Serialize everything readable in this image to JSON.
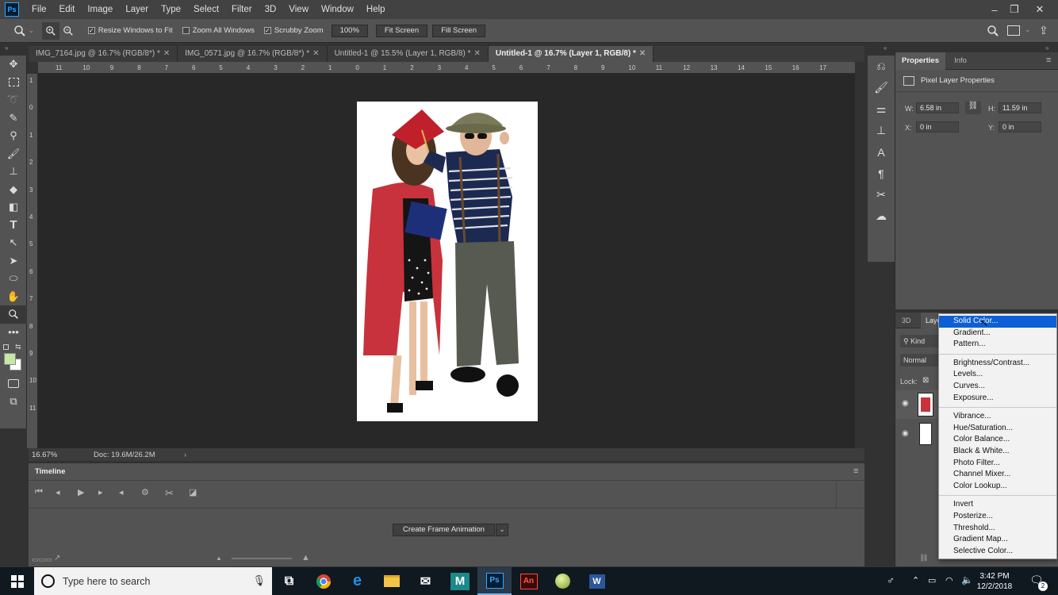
{
  "app": {
    "logo": "Ps"
  },
  "menubar": [
    "File",
    "Edit",
    "Image",
    "Layer",
    "Type",
    "Select",
    "Filter",
    "3D",
    "View",
    "Window",
    "Help"
  ],
  "window_controls": {
    "minimize": "–",
    "restore": "❐",
    "close": "✕"
  },
  "options": {
    "zoom_pct": "100%",
    "resize_windows": "Resize Windows to Fit",
    "zoom_all": "Zoom All Windows",
    "scrubby": "Scrubby Zoom",
    "fit_screen": "Fit Screen",
    "fill_screen": "Fill Screen"
  },
  "tabs": [
    {
      "label": "IMG_7164.jpg @ 16.7% (RGB/8*) *",
      "close": "✕"
    },
    {
      "label": "IMG_0571.jpg @ 16.7% (RGB/8*) *",
      "close": "✕"
    },
    {
      "label": "Untitled-1 @ 15.5% (Layer 1, RGB/8) *",
      "close": "✕"
    },
    {
      "label": "Untitled-1 @ 16.7% (Layer 1, RGB/8) *",
      "close": "✕"
    }
  ],
  "ruler_h": [
    "11",
    "10",
    "9",
    "8",
    "7",
    "6",
    "5",
    "4",
    "3",
    "2",
    "1",
    "0",
    "1",
    "2",
    "3",
    "4",
    "5",
    "6",
    "7",
    "8",
    "9",
    "10",
    "11",
    "12",
    "13",
    "14",
    "15",
    "16",
    "17"
  ],
  "ruler_v": [
    "1",
    "0",
    "1",
    "2",
    "3",
    "4",
    "5",
    "6",
    "7",
    "8",
    "9",
    "10",
    "11"
  ],
  "status": {
    "zoom": "16.67%",
    "doc": "Doc: 19.6M/26.2M",
    "arrow": "›"
  },
  "timeline": {
    "title": "Timeline",
    "create_button": "Create Frame Animation"
  },
  "properties": {
    "tab_properties": "Properties",
    "tab_info": "Info",
    "heading": "Pixel Layer Properties",
    "w_label": "W:",
    "w_value": "6.58 in",
    "h_label": "H:",
    "h_value": "11.59 in",
    "x_label": "X:",
    "x_value": "0 in",
    "y_label": "Y:",
    "y_value": "0 in"
  },
  "layers_panel": {
    "tab_3d": "3D",
    "tab_layers": "Layers",
    "kind": "Kind",
    "blend": "Normal",
    "lock": "Lock:"
  },
  "adjustment_menu": {
    "group1": [
      "Solid Color...",
      "Gradient...",
      "Pattern..."
    ],
    "group2": [
      "Brightness/Contrast...",
      "Levels...",
      "Curves...",
      "Exposure..."
    ],
    "group3": [
      "Vibrance...",
      "Hue/Saturation...",
      "Color Balance...",
      "Black & White...",
      "Photo Filter...",
      "Channel Mixer...",
      "Color Lookup..."
    ],
    "group4": [
      "Invert",
      "Posterize...",
      "Threshold...",
      "Gradient Map...",
      "Selective Color..."
    ]
  },
  "taskbar": {
    "search_placeholder": "Type here to search",
    "time": "3:42 PM",
    "date": "12/2/2018",
    "notifications": "2"
  },
  "colors": {
    "accent": "#0c5fd6",
    "gown": "#c8323c",
    "ps_blue": "#31a8ff"
  }
}
